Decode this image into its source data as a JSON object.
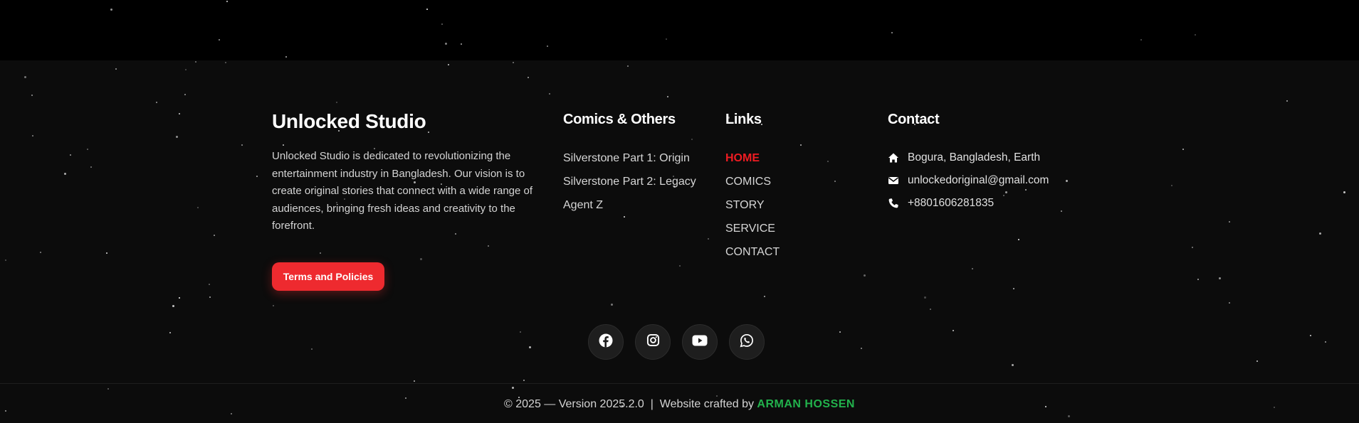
{
  "brand": {
    "title": "Unlocked Studio",
    "description": "Unlocked Studio is dedicated to revolutionizing the entertainment industry in Bangladesh. Our vision is to create original stories that connect with a wide range of audiences, bringing fresh ideas and creativity to the forefront.",
    "terms_button": "Terms and Policies"
  },
  "comics": {
    "title": "Comics & Others",
    "items": [
      "Silverstone Part 1: Origin",
      "Silverstone Part 2: Legacy",
      "Agent Z"
    ]
  },
  "links": {
    "title": "Links",
    "items": [
      "HOME",
      "COMICS",
      "STORY",
      "SERVICE",
      "CONTACT"
    ],
    "active": "HOME"
  },
  "contact": {
    "title": "Contact",
    "address": "Bogura, Bangladesh, Earth",
    "email": "unlockedoriginal@gmail.com",
    "phone": "+8801606281835",
    "icons": [
      "home-icon",
      "envelope-icon",
      "phone-icon"
    ]
  },
  "social": [
    "facebook-icon",
    "instagram-icon",
    "youtube-icon",
    "whatsapp-icon"
  ],
  "copyright": {
    "prefix": "© 2025 — Version 2025.2.0  |  Website crafted by ",
    "author": "ARMAN HOSSEN"
  },
  "colors": {
    "accent_red": "#ee2a2f",
    "active_link": "#ee1c22",
    "author_green": "#22b24c",
    "footer_bg": "#0c0c0c"
  }
}
